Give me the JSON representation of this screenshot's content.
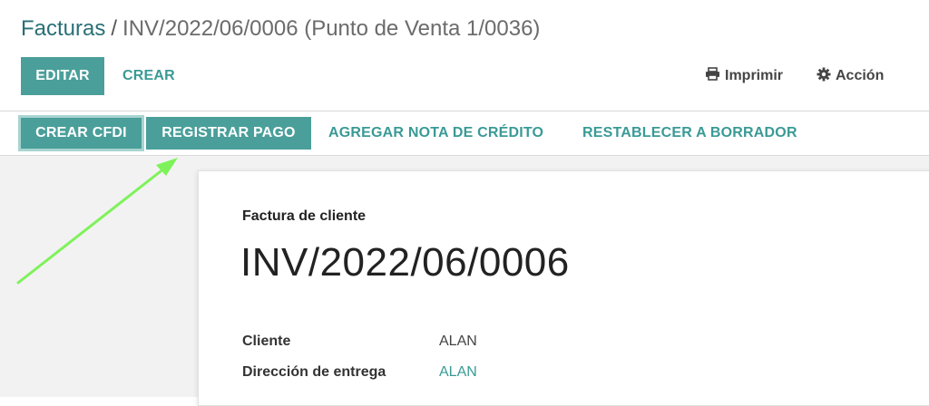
{
  "breadcrumb": {
    "parent": "Facturas",
    "separator": "/",
    "current": "INV/2022/06/0006 (Punto de Venta 1/0036)"
  },
  "toolbar": {
    "edit_label": "EDITAR",
    "create_label": "CREAR",
    "print_label": "Imprimir",
    "print_icon": "printer-icon",
    "action_label": "Acción",
    "action_icon": "gear-icon"
  },
  "statusbar": {
    "create_cfdi_label": "CREAR CFDI",
    "register_payment_label": "REGISTRAR PAGO",
    "add_credit_note_label": "AGREGAR NOTA DE CRÉDITO",
    "reset_to_draft_label": "RESTABLECER A BORRADOR"
  },
  "sheet": {
    "document_type": "Factura de cliente",
    "title": "INV/2022/06/0006",
    "fields": [
      {
        "label": "Cliente",
        "value": "ALAN"
      },
      {
        "label": "Dirección de entrega",
        "value": "ALAN"
      }
    ]
  },
  "annotation": {
    "arrow_color": "#7ef25a",
    "arrow_target": "register-payment-button"
  },
  "colors": {
    "primary": "#4a9f9a",
    "link": "#3a9a95",
    "breadcrumb_link": "#2a6f77"
  }
}
